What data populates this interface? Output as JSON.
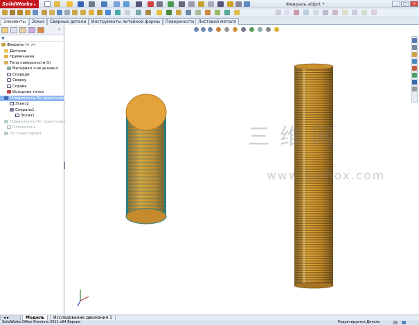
{
  "app": {
    "logo": "SolidWorks",
    "document_title": "Февраль.sldprt *"
  },
  "tabs": [
    "Элементы",
    "Эскиз",
    "Сварные детали",
    "Инструменты литейной формы",
    "Поверхности",
    "Листовой металл"
  ],
  "feature_tree": {
    "filter_icon": "funnel-icon",
    "items": [
      {
        "label": "Февраль  (< >)",
        "icon": "part-icon",
        "state": "normal"
      },
      {
        "label": "Датчики",
        "icon": "sensor-icon",
        "state": "normal"
      },
      {
        "label": "Примечания",
        "icon": "annotation-icon",
        "state": "normal"
      },
      {
        "label": "Тела поверхности(1)",
        "icon": "surface-body-icon",
        "state": "normal"
      },
      {
        "label": "Материал <не указан>",
        "icon": "material-icon",
        "state": "normal"
      },
      {
        "label": "Спереди",
        "icon": "plane-icon",
        "state": "normal"
      },
      {
        "label": "Сверху",
        "icon": "plane-icon",
        "state": "normal"
      },
      {
        "label": "Справа",
        "icon": "plane-icon",
        "state": "normal"
      },
      {
        "label": "Исходная точка",
        "icon": "origin-icon",
        "state": "normal"
      },
      {
        "label": "Поверхность-По траектории",
        "icon": "sweep-icon",
        "state": "selected"
      },
      {
        "label": "Эскиз2",
        "icon": "sketch-icon",
        "state": "normal"
      },
      {
        "label": "Спираль1",
        "icon": "helix-icon",
        "state": "normal"
      },
      {
        "label": "Эскиз1",
        "icon": "sketch-icon",
        "state": "normal"
      },
      {
        "label": "Поверхность-По траектории",
        "icon": "sweep-icon",
        "state": "gray"
      },
      {
        "label": "Плоскость1",
        "icon": "plane-icon",
        "state": "gray"
      },
      {
        "label": "По траектории1",
        "icon": "sweep-icon",
        "state": "gray"
      }
    ]
  },
  "bottom_tabs": [
    "Модель",
    "Исследование движения 1"
  ],
  "status": {
    "left": "SolidWorks Office Premium 2011 x64 Версия",
    "right": "Редактируется Деталь"
  },
  "watermark": {
    "chinese": "三维网",
    "url": "www.3dmox.com"
  },
  "colors": {
    "accent": "#c4161c",
    "model_gold": "#d4952a",
    "model_teal": "#2e7d82",
    "selection": "#8fb8f0"
  }
}
